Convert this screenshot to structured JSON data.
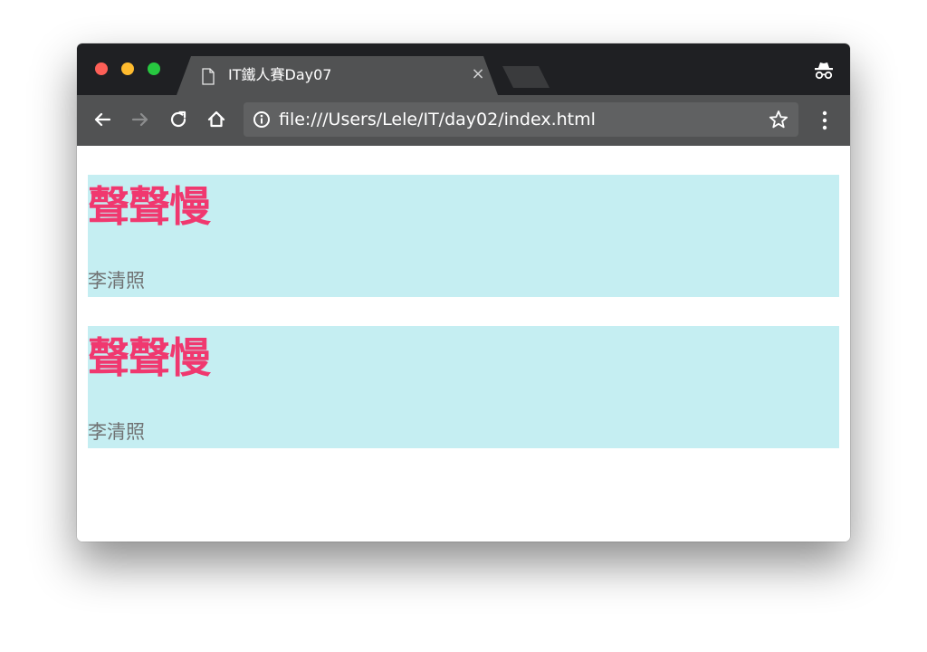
{
  "browser": {
    "tab": {
      "title": "IT鐵人賽Day07",
      "close_symbol": "×",
      "page_icon": "page-icon"
    },
    "toolbar": {
      "back_icon": "back-arrow-icon",
      "forward_icon": "forward-arrow-icon",
      "reload_icon": "reload-icon",
      "home_icon": "home-icon",
      "menu_icon": "menu-icon"
    },
    "address_bar": {
      "url": "file:///Users/Lele/IT/day02/index.html",
      "info_icon": "info-icon",
      "bookmark_icon": "star-icon"
    },
    "incognito_icon": "incognito-icon"
  },
  "page": {
    "cards": [
      {
        "title": "聲聲慢",
        "author": "李清照"
      },
      {
        "title": "聲聲慢",
        "author": "李清照"
      }
    ]
  },
  "colors": {
    "titlebar": "#1f2023",
    "toolbar": "#515253",
    "omnibox": "#606162",
    "card_background": "#c5eef2",
    "title_color": "#f0386f",
    "author_color": "#707273",
    "close_red": "#fd5f57",
    "minimize_yellow": "#febb2e",
    "zoom_green": "#27c840"
  }
}
